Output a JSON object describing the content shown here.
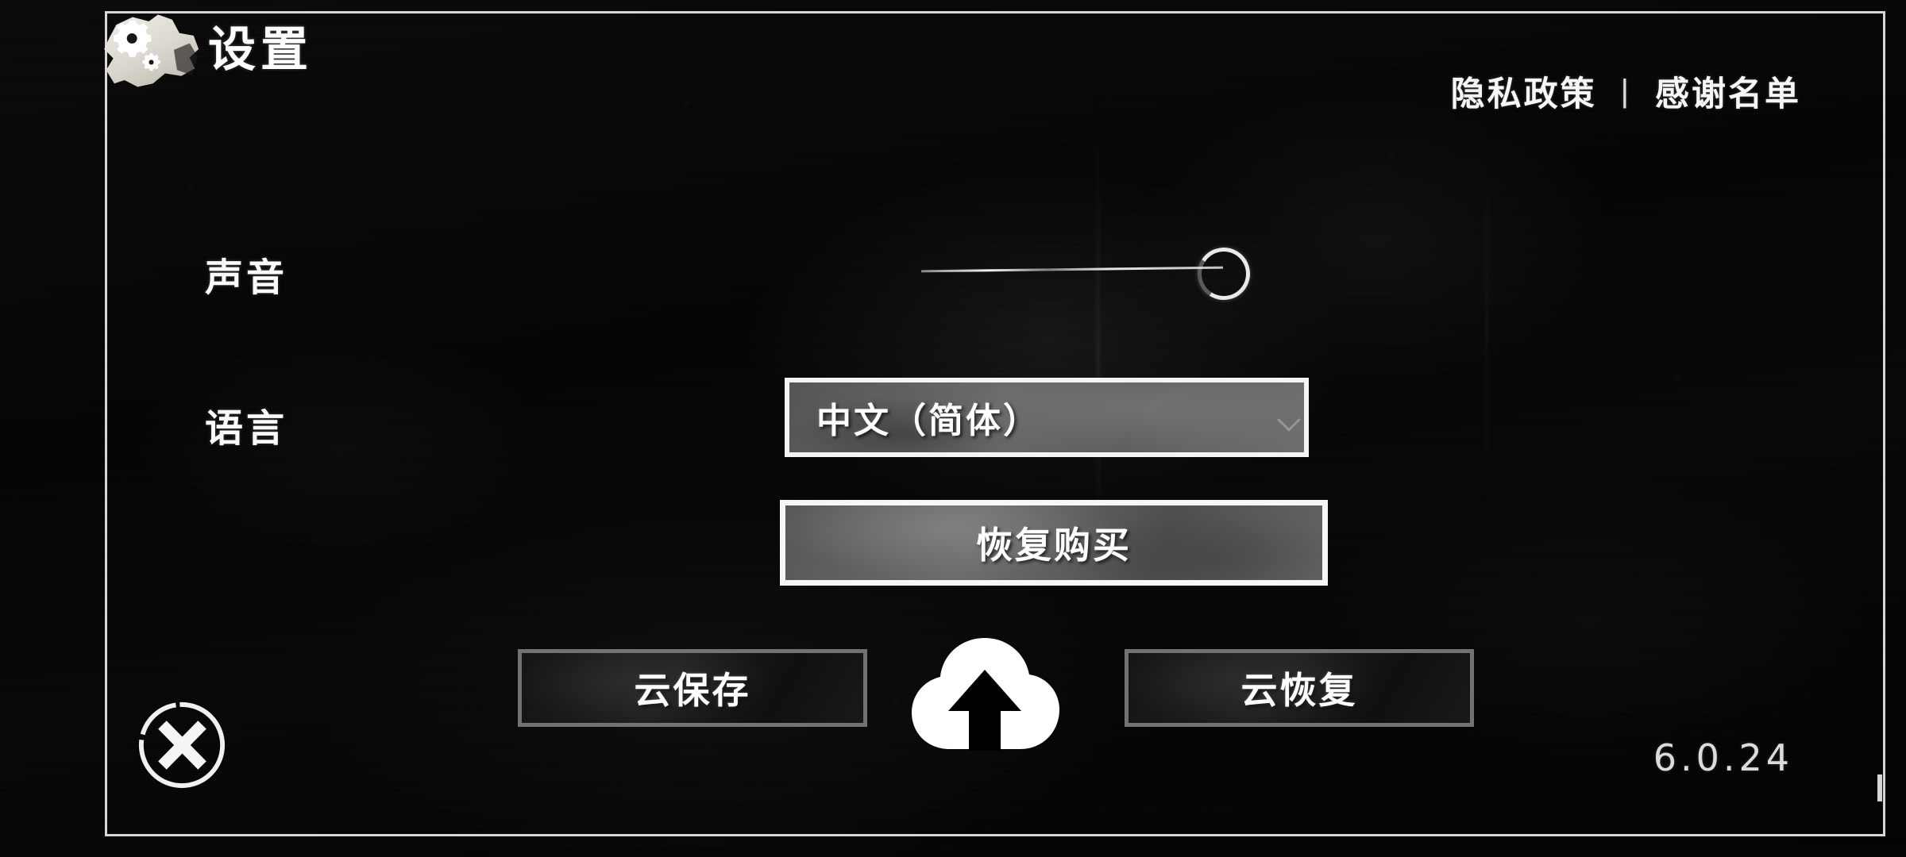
{
  "screen": {
    "title": "设置",
    "title_icon": "gear-icon",
    "background_color": "#050505",
    "frame_color": "#f4f4f4",
    "text_color": "#fdfdfd"
  },
  "header": {
    "privacy_policy_label": "隐私政策",
    "separator": "|",
    "credits_label": "感谢名单"
  },
  "settings": {
    "sound": {
      "label": "声音",
      "control": "slider",
      "value_percent": 100,
      "knob_icon": "circle-knob-icon"
    },
    "language": {
      "label": "语言",
      "control": "dropdown",
      "selected_value": "中文（简体）",
      "chevron_icon": "chevron-down-icon"
    }
  },
  "actions": {
    "restore_purchase_label": "恢复购买",
    "cloud_save_label": "云保存",
    "cloud_restore_label": "云恢复",
    "cloud_icon": "cloud-upload-icon",
    "close_icon": "close-x-circle-icon"
  },
  "footer": {
    "version": "6.0.24"
  }
}
